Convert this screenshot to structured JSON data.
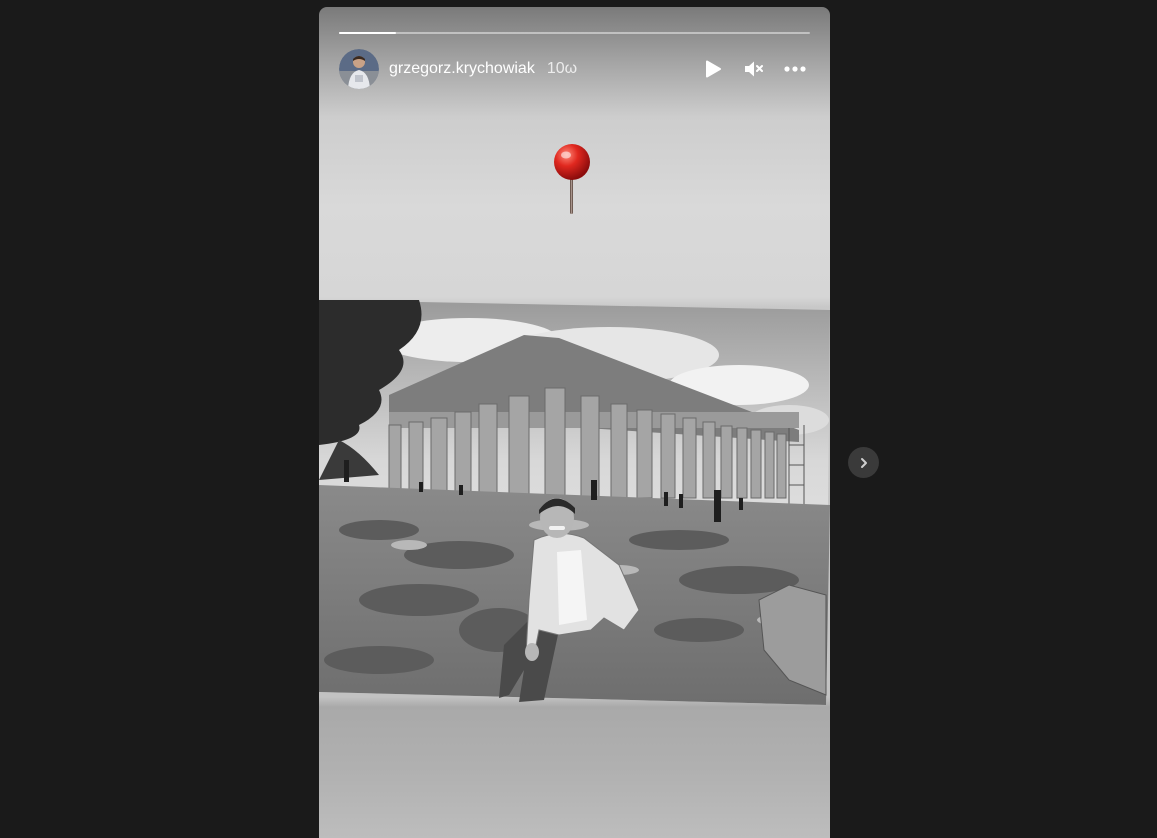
{
  "story": {
    "progress_fraction": 0.12,
    "user": {
      "username": "grzegorz.krychowiak",
      "timestamp": "10ω"
    },
    "controls": {
      "play_icon": "play-icon",
      "mute_icon": "muted-speaker-icon",
      "more_icon": "more-horizontal-icon"
    },
    "sticker": "red-pushpin",
    "media": "black-and-white photo of a man kneeling on rocky ground in front of the Parthenon"
  },
  "navigation": {
    "next_icon": "chevron-right-icon"
  },
  "colors": {
    "background": "#1a1a1a",
    "text": "#ffffff",
    "pin_red": "#d81f1f",
    "nav_button": "#3a3a3a"
  }
}
